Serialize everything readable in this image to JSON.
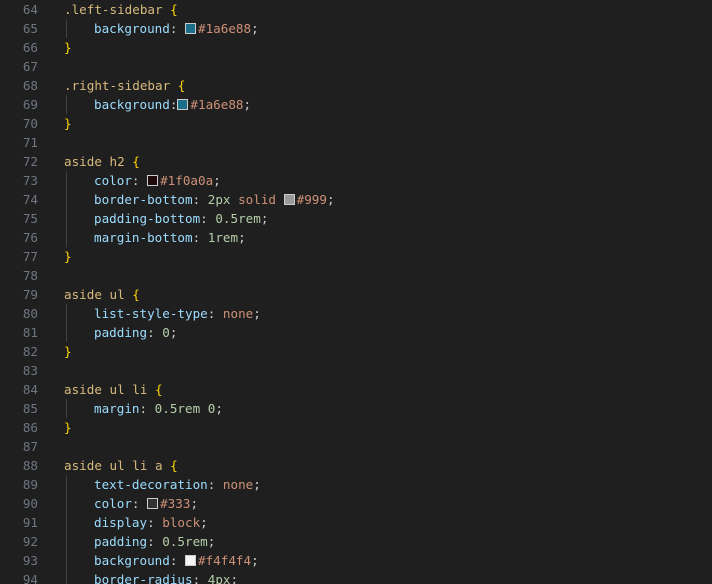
{
  "editor": {
    "language": "css",
    "colors": {
      "background": "#1f1f1f",
      "line_number": "#6e7681",
      "selector": "#d7ba7d",
      "brace": "#ffd700",
      "property": "#9cdcfe",
      "number": "#b5cea8",
      "value": "#ce9178"
    },
    "lines": [
      {
        "n": "64",
        "indent": false,
        "tokens": [
          {
            "t": ".left-sidebar ",
            "c": "sel"
          },
          {
            "t": "{",
            "c": "brace"
          }
        ]
      },
      {
        "n": "65",
        "indent": true,
        "tokens": [
          {
            "t": "background",
            "c": "prop"
          },
          {
            "t": ": ",
            "c": "punc"
          },
          {
            "t": "#1a6e88",
            "c": "val",
            "swatch": "#1a6e88"
          },
          {
            "t": ";",
            "c": "punc"
          }
        ]
      },
      {
        "n": "66",
        "indent": false,
        "tokens": [
          {
            "t": "}",
            "c": "brace"
          }
        ]
      },
      {
        "n": "67",
        "indent": false,
        "tokens": []
      },
      {
        "n": "68",
        "indent": false,
        "tokens": [
          {
            "t": ".right-sidebar ",
            "c": "sel"
          },
          {
            "t": "{",
            "c": "brace"
          }
        ]
      },
      {
        "n": "69",
        "indent": true,
        "tokens": [
          {
            "t": "background",
            "c": "prop"
          },
          {
            "t": ":",
            "c": "punc"
          },
          {
            "t": "#1a6e88",
            "c": "val",
            "swatch": "#1a6e88"
          },
          {
            "t": ";",
            "c": "punc"
          }
        ]
      },
      {
        "n": "70",
        "indent": false,
        "tokens": [
          {
            "t": "}",
            "c": "brace"
          }
        ]
      },
      {
        "n": "71",
        "indent": false,
        "tokens": []
      },
      {
        "n": "72",
        "indent": false,
        "tokens": [
          {
            "t": "aside h2 ",
            "c": "sel"
          },
          {
            "t": "{",
            "c": "brace"
          }
        ]
      },
      {
        "n": "73",
        "indent": true,
        "tokens": [
          {
            "t": "color",
            "c": "prop"
          },
          {
            "t": ": ",
            "c": "punc"
          },
          {
            "t": "#1f0a0a",
            "c": "val",
            "swatch": "#1f0a0a"
          },
          {
            "t": ";",
            "c": "punc"
          }
        ]
      },
      {
        "n": "74",
        "indent": true,
        "tokens": [
          {
            "t": "border-bottom",
            "c": "prop"
          },
          {
            "t": ": ",
            "c": "punc"
          },
          {
            "t": "2px",
            "c": "num"
          },
          {
            "t": " ",
            "c": "punc"
          },
          {
            "t": "solid",
            "c": "val"
          },
          {
            "t": " ",
            "c": "punc"
          },
          {
            "t": "#999",
            "c": "val",
            "swatch": "#999999"
          },
          {
            "t": ";",
            "c": "punc"
          }
        ]
      },
      {
        "n": "75",
        "indent": true,
        "tokens": [
          {
            "t": "padding-bottom",
            "c": "prop"
          },
          {
            "t": ": ",
            "c": "punc"
          },
          {
            "t": "0.5rem",
            "c": "num"
          },
          {
            "t": ";",
            "c": "punc"
          }
        ]
      },
      {
        "n": "76",
        "indent": true,
        "tokens": [
          {
            "t": "margin-bottom",
            "c": "prop"
          },
          {
            "t": ": ",
            "c": "punc"
          },
          {
            "t": "1rem",
            "c": "num"
          },
          {
            "t": ";",
            "c": "punc"
          }
        ]
      },
      {
        "n": "77",
        "indent": false,
        "tokens": [
          {
            "t": "}",
            "c": "brace"
          }
        ]
      },
      {
        "n": "78",
        "indent": false,
        "tokens": []
      },
      {
        "n": "79",
        "indent": false,
        "tokens": [
          {
            "t": "aside ul ",
            "c": "sel"
          },
          {
            "t": "{",
            "c": "brace"
          }
        ]
      },
      {
        "n": "80",
        "indent": true,
        "tokens": [
          {
            "t": "list-style-type",
            "c": "prop"
          },
          {
            "t": ": ",
            "c": "punc"
          },
          {
            "t": "none",
            "c": "val"
          },
          {
            "t": ";",
            "c": "punc"
          }
        ]
      },
      {
        "n": "81",
        "indent": true,
        "tokens": [
          {
            "t": "padding",
            "c": "prop"
          },
          {
            "t": ": ",
            "c": "punc"
          },
          {
            "t": "0",
            "c": "num"
          },
          {
            "t": ";",
            "c": "punc"
          }
        ]
      },
      {
        "n": "82",
        "indent": false,
        "tokens": [
          {
            "t": "}",
            "c": "brace"
          }
        ]
      },
      {
        "n": "83",
        "indent": false,
        "tokens": []
      },
      {
        "n": "84",
        "indent": false,
        "tokens": [
          {
            "t": "aside ul li ",
            "c": "sel"
          },
          {
            "t": "{",
            "c": "brace"
          }
        ]
      },
      {
        "n": "85",
        "indent": true,
        "tokens": [
          {
            "t": "margin",
            "c": "prop"
          },
          {
            "t": ": ",
            "c": "punc"
          },
          {
            "t": "0.5rem",
            "c": "num"
          },
          {
            "t": " ",
            "c": "punc"
          },
          {
            "t": "0",
            "c": "num"
          },
          {
            "t": ";",
            "c": "punc"
          }
        ]
      },
      {
        "n": "86",
        "indent": false,
        "tokens": [
          {
            "t": "}",
            "c": "brace"
          }
        ]
      },
      {
        "n": "87",
        "indent": false,
        "tokens": []
      },
      {
        "n": "88",
        "indent": false,
        "tokens": [
          {
            "t": "aside ul li a ",
            "c": "sel"
          },
          {
            "t": "{",
            "c": "brace"
          }
        ]
      },
      {
        "n": "89",
        "indent": true,
        "tokens": [
          {
            "t": "text-decoration",
            "c": "prop"
          },
          {
            "t": ": ",
            "c": "punc"
          },
          {
            "t": "none",
            "c": "val"
          },
          {
            "t": ";",
            "c": "punc"
          }
        ]
      },
      {
        "n": "90",
        "indent": true,
        "tokens": [
          {
            "t": "color",
            "c": "prop"
          },
          {
            "t": ": ",
            "c": "punc"
          },
          {
            "t": "#333",
            "c": "val",
            "swatch": "#333333"
          },
          {
            "t": ";",
            "c": "punc"
          }
        ]
      },
      {
        "n": "91",
        "indent": true,
        "tokens": [
          {
            "t": "display",
            "c": "prop"
          },
          {
            "t": ": ",
            "c": "punc"
          },
          {
            "t": "block",
            "c": "val"
          },
          {
            "t": ";",
            "c": "punc"
          }
        ]
      },
      {
        "n": "92",
        "indent": true,
        "tokens": [
          {
            "t": "padding",
            "c": "prop"
          },
          {
            "t": ": ",
            "c": "punc"
          },
          {
            "t": "0.5rem",
            "c": "num"
          },
          {
            "t": ";",
            "c": "punc"
          }
        ]
      },
      {
        "n": "93",
        "indent": true,
        "tokens": [
          {
            "t": "background",
            "c": "prop"
          },
          {
            "t": ": ",
            "c": "punc"
          },
          {
            "t": "#f4f4f4",
            "c": "val",
            "swatch": "#f4f4f4"
          },
          {
            "t": ";",
            "c": "punc"
          }
        ]
      },
      {
        "n": "94",
        "indent": true,
        "tokens": [
          {
            "t": "border-radius",
            "c": "prop"
          },
          {
            "t": ": ",
            "c": "punc"
          },
          {
            "t": "4px",
            "c": "num"
          },
          {
            "t": ";",
            "c": "punc"
          }
        ]
      }
    ]
  }
}
